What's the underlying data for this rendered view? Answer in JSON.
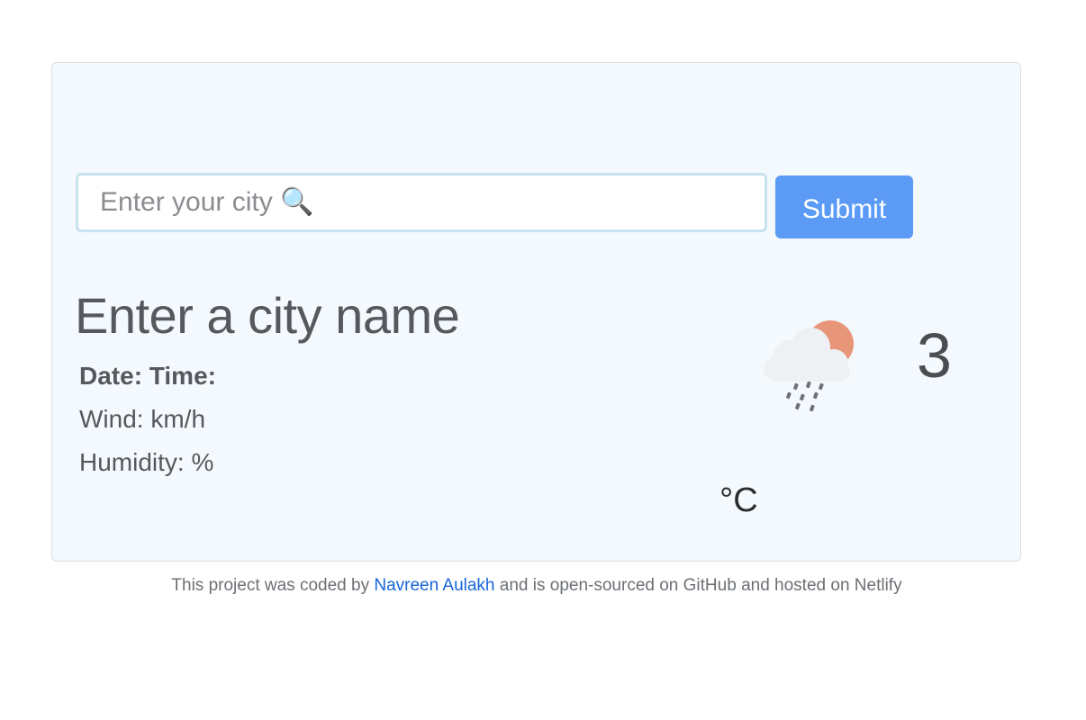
{
  "search": {
    "placeholder": "Enter your city 🔍",
    "value": ""
  },
  "submit_label": "Submit",
  "weather": {
    "city": "Enter a city name",
    "date_time": "Date: Time:",
    "wind": "Wind: km/h",
    "humidity": "Humidity: %",
    "temperature": "3",
    "unit": "°C",
    "icon": "cloud-rain-sun-icon"
  },
  "footer": {
    "prefix": "This project was coded by ",
    "author": "Navreen Aulakh",
    "suffix": " and is open-sourced on GitHub and hosted on Netlify"
  },
  "colors": {
    "card_bg": "#f4f9fd",
    "button": "#5b9bf6",
    "link": "#1565d8",
    "sun": "#e8967a"
  }
}
